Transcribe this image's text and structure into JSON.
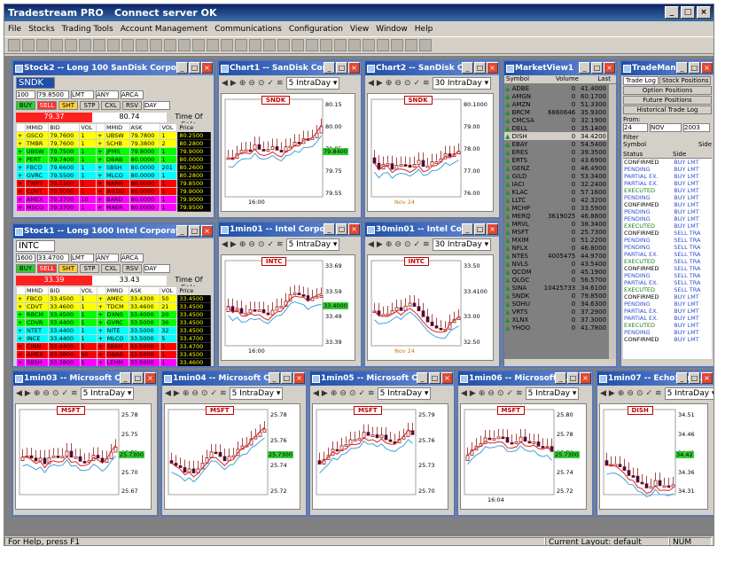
{
  "app": {
    "title": "Tradestream PRO",
    "connection": "Connect server OK"
  },
  "menu": [
    "File",
    "Stocks",
    "Trading Tools",
    "Account Management",
    "Communications",
    "Configuration",
    "View",
    "Window",
    "Help"
  ],
  "status": {
    "help": "For Help, press F1",
    "layout": "Current Layout: default",
    "num": "NUM"
  },
  "colors": {
    "bid_rows": [
      "#ffff00",
      "#00ff00",
      "#00ffff",
      "#ff0000",
      "#ff00ff"
    ]
  },
  "stock2": {
    "title": "Stock2 -- Long 100  SanDisk Corpor...",
    "symbol": "SNDK",
    "qty": "100",
    "price": "79.8500",
    "type": "LMT",
    "any": "ANY",
    "route": "ARCA",
    "buttons": [
      "BUY",
      "SELL",
      "SHT",
      "STP",
      "CXL",
      "RSV",
      "DAY"
    ],
    "bid": "79.37",
    "ask": "80.74",
    "tos": "Time Of Sale",
    "headers": [
      "MMID",
      "BID",
      "VOL",
      "MMID",
      "ASK",
      "VOL",
      "Price"
    ],
    "rows": [
      [
        "GSCO",
        "79.7600",
        "1",
        "UBSW",
        "79.7800",
        "1",
        "80.2500"
      ],
      [
        "TMBR",
        "79.7600",
        "1",
        "SCHB",
        "79.3800",
        "2",
        "80.2800"
      ],
      [
        "UBSW",
        "79.7500",
        "1",
        "JPMS",
        "79.8000",
        "1",
        "79.9000"
      ],
      [
        "PERT",
        "79.7400",
        "1",
        "DBAB",
        "80.0000",
        "1",
        "80.0000"
      ],
      [
        "FBCO",
        "79.6600",
        "1",
        "SBSH",
        "80.0000",
        "201",
        "80.2600"
      ],
      [
        "GVRC",
        "79.5500",
        "1",
        "MLCO",
        "80.0000",
        "1",
        "80.2800"
      ],
      [
        "TWPT",
        "79.5100",
        "1",
        "NAMR",
        "80.0000",
        "1",
        "79.8500"
      ],
      [
        "CDVT",
        "79.5000",
        "1",
        "WEDD",
        "80.0000",
        "1",
        "79.9000"
      ],
      [
        "AMEX",
        "79.3700",
        "10",
        "BARD",
        "80.0000",
        "1",
        "79.9000"
      ],
      [
        "MSCO",
        "79.3700",
        "1",
        "MAER",
        "80.0000",
        "1",
        "79.9500"
      ]
    ]
  },
  "stock1": {
    "title": "Stock1 -- Long 1600  Intel Corporati...",
    "symbol": "INTC",
    "qty": "1600",
    "price": "33.4700",
    "type": "LMT",
    "any": "ANY",
    "route": "ARCA",
    "buttons": [
      "BUY",
      "SELL",
      "SHT",
      "STP",
      "CXL",
      "RSV",
      "DAY"
    ],
    "bid": "33.39",
    "ask": "33.43",
    "tos": "Time Of Sale",
    "headers": [
      "MMID",
      "BID",
      "VOL",
      "MMID",
      "ASK",
      "VOL",
      "Price"
    ],
    "rows": [
      [
        "FBCO",
        "33.4500",
        "1",
        "AMEC",
        "33.4300",
        "50",
        "33.4500"
      ],
      [
        "CDVT",
        "33.4600",
        "1",
        "TDCM",
        "33.4600",
        "21",
        "33.4500"
      ],
      [
        "RBCM",
        "33.4500",
        "1",
        "DXNS",
        "33.4000",
        "20",
        "33.4500"
      ],
      [
        "CDVR",
        "33.4400",
        "1",
        "GVRC",
        "33.5000",
        "36",
        "33.4500"
      ],
      [
        "NTET",
        "33.4400",
        "1",
        "NITE",
        "33.5000",
        "32",
        "33.4500"
      ],
      [
        "INCE",
        "33.4400",
        "1",
        "MLCO",
        "33.5000",
        "5",
        "33.4700"
      ],
      [
        "CINN",
        "33.4400",
        "1",
        "SBSH",
        "33.5000",
        "1",
        "33.4700"
      ],
      [
        "AMEX",
        "33.3800",
        "50",
        "DBAB",
        "33.5000",
        "1",
        "33.4500"
      ],
      [
        "SBSH",
        "33.3800",
        "1",
        "LEHM",
        "33.5000",
        "1",
        "33.4600"
      ]
    ]
  },
  "charts": {
    "chart1": {
      "title": "Chart1 -- SanDisk Cor...",
      "period": "5 IntraDay",
      "symbol": "SNDK",
      "ticks": [
        "80.15",
        "80.00",
        "79.85",
        "79.75",
        "79.55"
      ],
      "tag": "79.8400",
      "xlabel": "16:00"
    },
    "chart2": {
      "title": "Chart2 -- SanDisk C...",
      "period": "30 IntraDay",
      "symbol": "SNDK",
      "ticks": [
        "80.1000",
        "79.00",
        "78.00",
        "77.00",
        "76.00"
      ],
      "xlabel": "Nov 24"
    },
    "min01": {
      "title": "1min01 -- Intel Corpo...",
      "period": "5 IntraDay",
      "symbol": "INTC",
      "ticks": [
        "33.69",
        "33.59",
        "33.49",
        "33.39"
      ],
      "tag": "33.4000",
      "xlabel": "16:00"
    },
    "min30": {
      "title": "30min01 -- Intel Cor...",
      "period": "30 IntraDay",
      "symbol": "INTC",
      "ticks": [
        "33.50",
        "33.4100",
        "33.00",
        "32.50"
      ],
      "xlabel": "Nov 24"
    },
    "min03": {
      "title": "1min03 -- Microsoft C...",
      "period": "5 IntraDay",
      "symbol": "MSFT",
      "ticks": [
        "25.78",
        "25.75",
        "25.73",
        "25.70",
        "25.67"
      ],
      "tag": "25.7300"
    },
    "min04": {
      "title": "1min04 -- Microsoft C...",
      "period": "5 IntraDay",
      "symbol": "MSFT",
      "ticks": [
        "25.78",
        "25.76",
        "25.74",
        "25.72"
      ],
      "tag": "25.7300"
    },
    "min05": {
      "title": "1min05 -- Microsoft C...",
      "period": "5 IntraDay",
      "symbol": "MSFT",
      "ticks": [
        "25.79",
        "25.76",
        "25.73",
        "25.70"
      ],
      "tag": ""
    },
    "min06": {
      "title": "1min06 -- Microsoft C...",
      "period": "5 IntraDay",
      "symbol": "MSFT",
      "ticks": [
        "25.80",
        "25.78",
        "25.76",
        "25.74",
        "25.72"
      ],
      "tag": "25.7300",
      "xlabel": "16:04"
    },
    "min07": {
      "title": "1min07 -- EchoStar ...",
      "period": "5 IntraDay",
      "symbol": "DISH",
      "ticks": [
        "34.51",
        "34.46",
        "34.41",
        "34.36",
        "34.31"
      ],
      "tag": "34.42"
    }
  },
  "marketview": {
    "title": "MarketView1",
    "headers": [
      "Symbol",
      "Volume",
      "Last"
    ],
    "rows": [
      [
        "ADBE",
        "0",
        "41.4000"
      ],
      [
        "AMGN",
        "0",
        "60.1700"
      ],
      [
        "AMZN",
        "0",
        "51.3300"
      ],
      [
        "BRCM",
        "6860646",
        "35.9300"
      ],
      [
        "CMCSA",
        "0",
        "32.1900"
      ],
      [
        "DELL",
        "0",
        "35.1400"
      ],
      [
        "DISH",
        "0",
        "34.4200"
      ],
      [
        "EBAY",
        "0",
        "54.5400"
      ],
      [
        "ERES",
        "0",
        "39.3500"
      ],
      [
        "ERTS",
        "0",
        "43.6900"
      ],
      [
        "GENZ",
        "0",
        "46.4900"
      ],
      [
        "GILD",
        "0",
        "53.3400"
      ],
      [
        "IACI",
        "0",
        "32.2400"
      ],
      [
        "KLAC",
        "0",
        "57.1600"
      ],
      [
        "LLTC",
        "0",
        "42.3200"
      ],
      [
        "MCHP",
        "0",
        "33.5900"
      ],
      [
        "MERQ",
        "3619025",
        "46.8800"
      ],
      [
        "MRVL",
        "0",
        "38.3400"
      ],
      [
        "MSFT",
        "0",
        "25.7300"
      ],
      [
        "MXIM",
        "0",
        "51.2200"
      ],
      [
        "NFLX",
        "0",
        "46.8000"
      ],
      [
        "NTES",
        "4005475",
        "44.9700"
      ],
      [
        "NVLS",
        "0",
        "43.5400"
      ],
      [
        "QCOM",
        "0",
        "45.1900"
      ],
      [
        "QLGC",
        "0",
        "56.5700"
      ],
      [
        "SINA",
        "10425733",
        "34.6100"
      ],
      [
        "SNDK",
        "0",
        "79.8500"
      ],
      [
        "SOHU",
        "0",
        "34.6300"
      ],
      [
        "VRTS",
        "0",
        "37.2900"
      ],
      [
        "XLNX",
        "0",
        "37.3000"
      ],
      [
        "YHOO",
        "0",
        "41.7800"
      ]
    ]
  },
  "trademan": {
    "title": "TradeMan...",
    "tabs": [
      "Trade Log",
      "Stock Positions",
      "Option Positions",
      "Future Positions",
      "Historical Trade Log"
    ],
    "from_label": "From:",
    "day": "24",
    "month": "NOV",
    "year": "2003",
    "filter_label": "Filter",
    "symbol_label": "Symbol",
    "side_label": "Side",
    "headers": [
      "Status",
      "Side"
    ],
    "rows": [
      [
        "CONFIRMED",
        "BUY LMT"
      ],
      [
        "PENDING",
        "BUY LMT"
      ],
      [
        "PARTIAL EX.",
        "BUY LMT"
      ],
      [
        "PARTIAL EX.",
        "BUY LMT"
      ],
      [
        "EXECUTED",
        "BUY LMT"
      ],
      [
        "PENDING",
        "BUY LMT"
      ],
      [
        "CONFIRMED",
        "BUY LMT"
      ],
      [
        "PENDING",
        "BUY LMT"
      ],
      [
        "PENDING",
        "BUY LMT"
      ],
      [
        "EXECUTED",
        "BUY LMT"
      ],
      [
        "CONFIRMED",
        "SELL TRA"
      ],
      [
        "PENDING",
        "SELL TRA"
      ],
      [
        "PENDING",
        "SELL TRA"
      ],
      [
        "PARTIAL EX.",
        "SELL TRA"
      ],
      [
        "EXECUTED",
        "SELL TRA"
      ],
      [
        "CONFIRMED",
        "SELL TRA"
      ],
      [
        "PENDING",
        "SELL TRA"
      ],
      [
        "PARTIAL EX.",
        "SELL TRA"
      ],
      [
        "EXECUTED",
        "SELL TRA"
      ],
      [
        "CONFIRMED",
        "BUY LMT"
      ],
      [
        "PENDING",
        "BUY LMT"
      ],
      [
        "PARTIAL EX.",
        "BUY LMT"
      ],
      [
        "PARTIAL EX.",
        "BUY LMT"
      ],
      [
        "EXECUTED",
        "BUY LMT"
      ],
      [
        "PENDING",
        "BUY LMT"
      ],
      [
        "CONFIRMED",
        "BUY LMT"
      ]
    ]
  }
}
